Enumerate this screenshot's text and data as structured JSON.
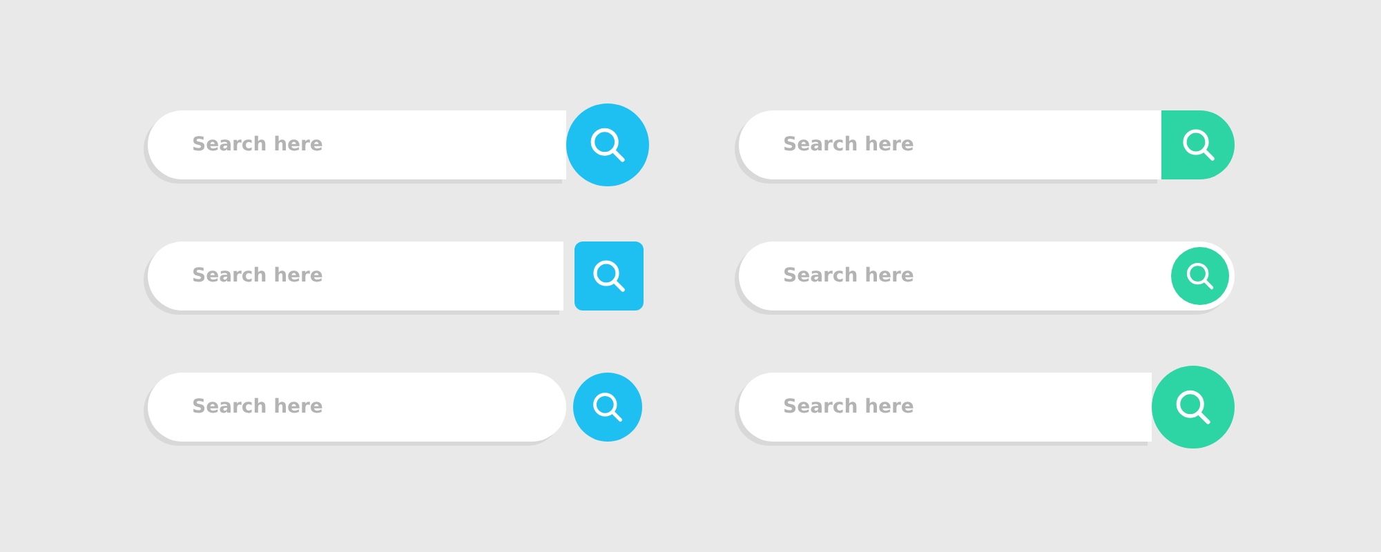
{
  "search_bars": [
    {
      "placeholder": "Search here",
      "kind": "overlap-circle",
      "color": "#1ec0f2"
    },
    {
      "placeholder": "Search here",
      "kind": "attached-end",
      "color": "#2dd4a4"
    },
    {
      "placeholder": "Search here",
      "kind": "square-separate",
      "color": "#1ec0f2"
    },
    {
      "placeholder": "Search here",
      "kind": "inset-circle",
      "color": "#2dd4a4"
    },
    {
      "placeholder": "Search here",
      "kind": "circle-separate",
      "color": "#1ec0f2"
    },
    {
      "placeholder": "Search here",
      "kind": "overlap-circle-wide",
      "color": "#2dd4a4"
    }
  ]
}
